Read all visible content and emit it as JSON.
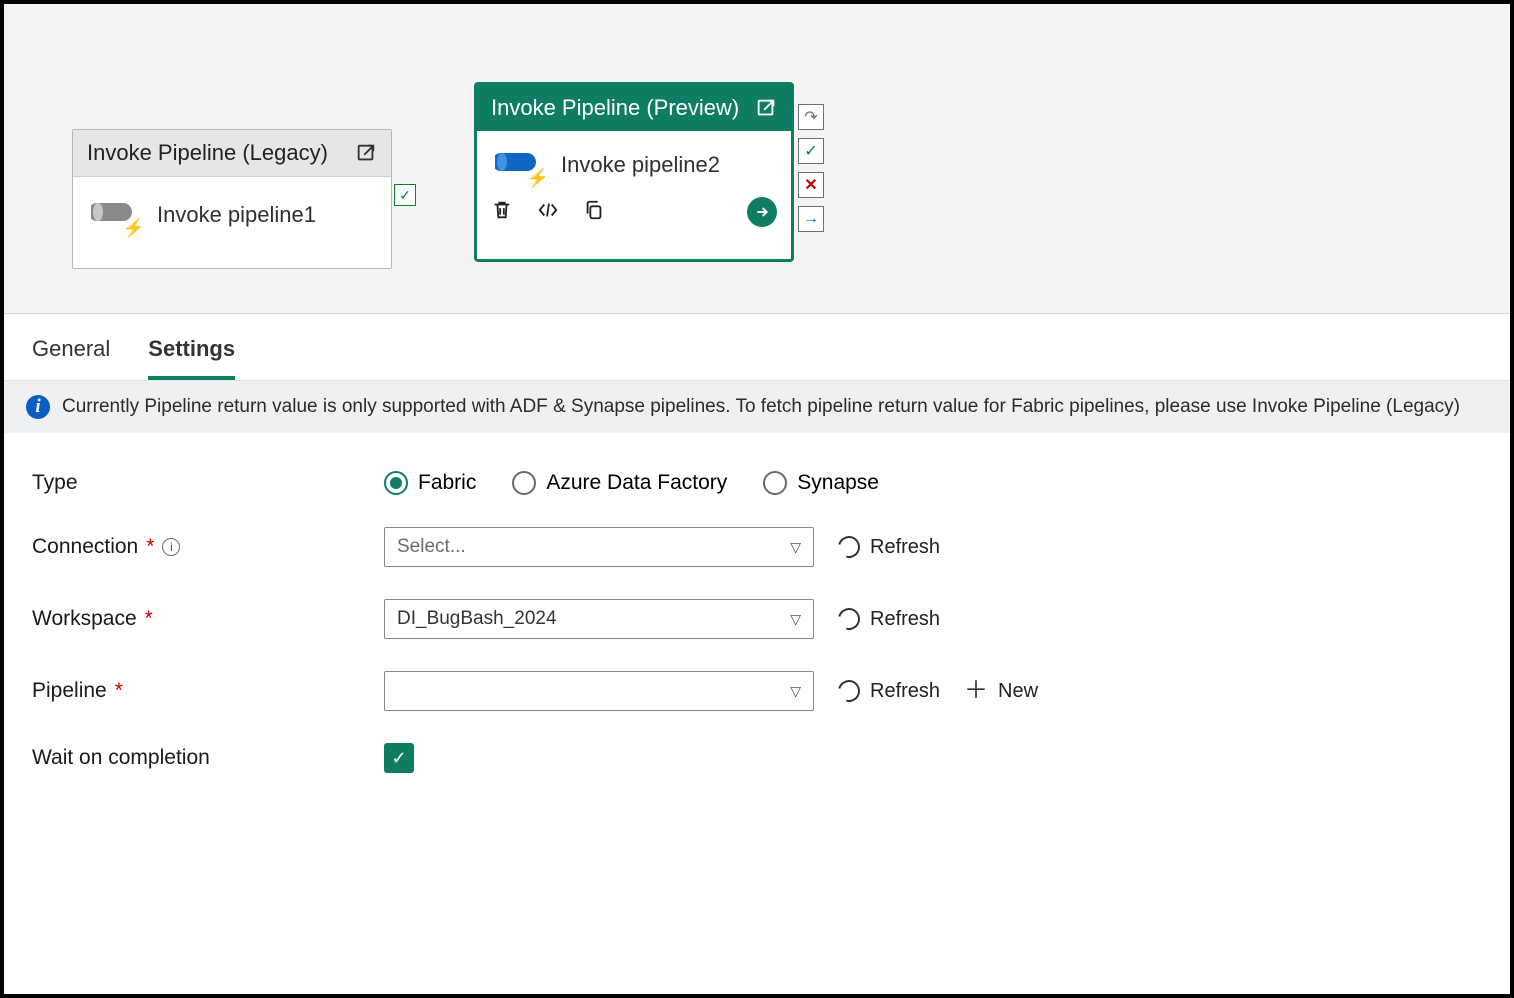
{
  "canvas": {
    "legacy_card": {
      "title": "Invoke Pipeline (Legacy)",
      "name": "Invoke pipeline1"
    },
    "selected_card": {
      "title": "Invoke Pipeline (Preview)",
      "name": "Invoke pipeline2"
    }
  },
  "tabs": {
    "general": "General",
    "settings": "Settings"
  },
  "info": "Currently Pipeline return value is only supported with ADF & Synapse pipelines. To fetch pipeline return value for Fabric pipelines, please use Invoke Pipeline (Legacy)",
  "form": {
    "type_label": "Type",
    "type_options": {
      "fabric": "Fabric",
      "adf": "Azure Data Factory",
      "synapse": "Synapse"
    },
    "type_selected": "fabric",
    "connection_label": "Connection",
    "connection_placeholder": "Select...",
    "workspace_label": "Workspace",
    "workspace_value": "DI_BugBash_2024",
    "pipeline_label": "Pipeline",
    "pipeline_value": "",
    "wait_label": "Wait on completion",
    "refresh_label": "Refresh",
    "new_label": "New"
  }
}
